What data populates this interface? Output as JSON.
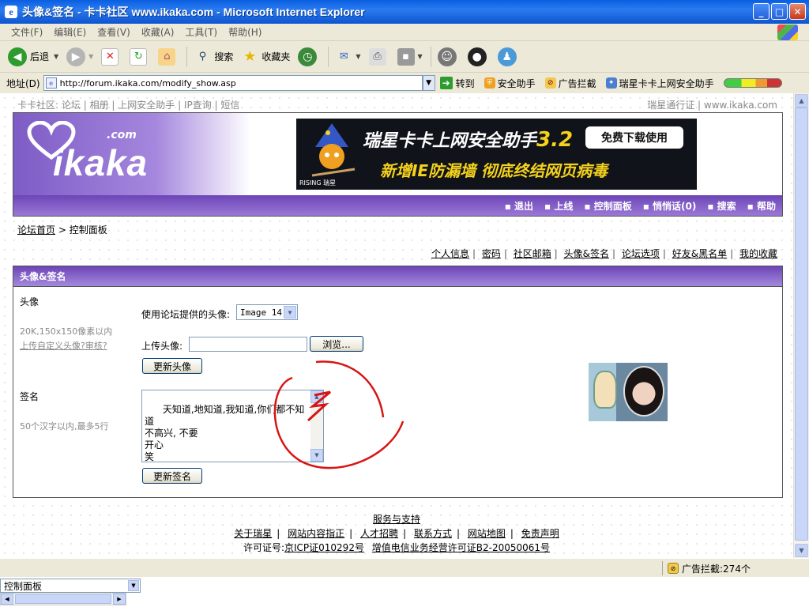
{
  "window": {
    "title": "头像&签名 - 卡卡社区 www.ikaka.com - Microsoft Internet Explorer",
    "min": "_",
    "max": "□",
    "close": "✕"
  },
  "menu": [
    "文件(F)",
    "编辑(E)",
    "查看(V)",
    "收藏(A)",
    "工具(T)",
    "帮助(H)"
  ],
  "toolbar": {
    "back": "后退",
    "search": "搜索",
    "favorites": "收藏夹"
  },
  "address": {
    "label": "地址(D)",
    "url": "http://forum.ikaka.com/modify_show.asp",
    "go": "转到",
    "links": [
      "安全助手",
      "广告拦截",
      "瑞星卡卡上网安全助手"
    ]
  },
  "page": {
    "topnav": {
      "prefix": "卡卡社区:",
      "items": [
        "论坛",
        "相册",
        "上网安全助手",
        "IP查询",
        "短信"
      ]
    },
    "topnav_right": [
      "瑞星通行证",
      "www.ikaka.com"
    ],
    "logo": {
      "text": "ikaka",
      "suffix": ".com"
    },
    "banner": {
      "line1": "瑞星卡卡上网安全助手",
      "version": "3.2",
      "button": "免费下载使用",
      "line2": "新增IE防漏墙 彻底终结网页病毒",
      "brand": "RISING 瑞星"
    },
    "mainnav": [
      "退出",
      "上线",
      "控制面板",
      "悄悄话(0)",
      "搜索",
      "帮助"
    ],
    "breadcrumb": {
      "home": "论坛首页",
      "sep": " > ",
      "current": "控制面板"
    },
    "subnav": [
      "个人信息",
      "密码",
      "社区邮箱",
      "头像&签名",
      "论坛选项",
      "好友&黑名单",
      "我的收藏"
    ],
    "panel": {
      "title": "头像&签名",
      "avatar_label": "头像",
      "avatar_hint": "20K,150x150像素以内",
      "avatar_custom_link": "上传自定义头像?审核?",
      "forum_avatar_label": "使用论坛提供的头像:",
      "forum_avatar_value": "Image 14",
      "upload_label": "上传头像:",
      "browse_button": "浏览...",
      "update_avatar_button": "更新头像",
      "signature_label": "签名",
      "signature_hint": "50个汉字以内,最多5行",
      "signature_text": "天知道,地知道,我知道,你们都不知道\n不高兴, 不要\n开心\n笑",
      "update_signature_button": "更新签名"
    },
    "footer": {
      "service": "服务与支持",
      "links": [
        "关于瑞星",
        "网站内容指正",
        "人才招聘",
        "联系方式",
        "网站地图",
        "免责声明"
      ],
      "license_prefix": "许可证号:",
      "icp": "京ICP证010292号",
      "telecom": "增值电信业务经营许可证B2-20050061号"
    }
  },
  "status": {
    "ad_block": "广告拦截:274个"
  },
  "bottom": {
    "tree_value": "控制面板"
  },
  "colors": {
    "purple": "#7d5cc5",
    "annotation": "#d81414"
  }
}
